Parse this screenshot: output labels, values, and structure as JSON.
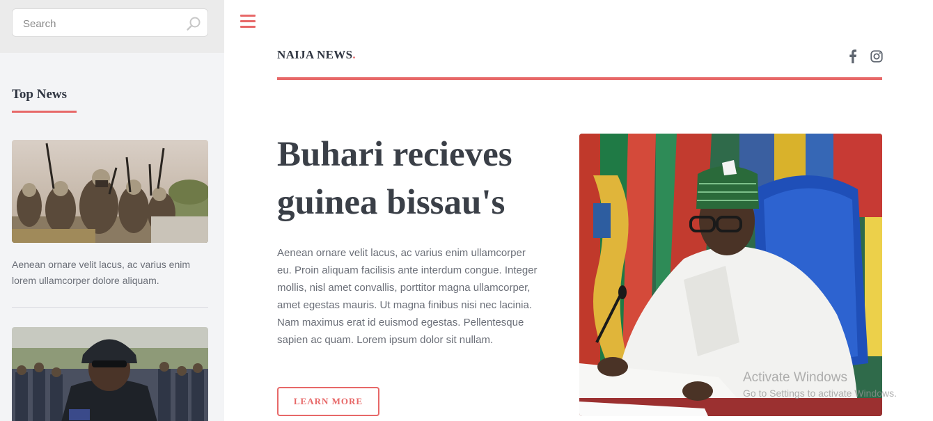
{
  "sidebar": {
    "search": {
      "placeholder": "Search"
    },
    "top_news": {
      "title": "Top News",
      "items": [
        {
          "excerpt": "Aenean ornare velit lacus, ac varius enim lorem ullamcorper dolore aliquam."
        }
      ]
    }
  },
  "header": {
    "brand": "NAIJA NEWS",
    "brand_suffix": ".",
    "social_icons": [
      "facebook-icon",
      "instagram-icon"
    ]
  },
  "article": {
    "headline": "Buhari recieves guinea bissau's",
    "body": "Aenean ornare velit lacus, ac varius enim ullamcorper eu. Proin aliquam facilisis ante interdum congue. Integer mollis, nisl amet convallis, porttitor magna ullamcorper, amet egestas mauris. Ut magna finibus nisi nec lacinia. Nam maximus erat id euismod egestas. Pellentesque sapien ac quam. Lorem ipsum dolor sit nullam.",
    "cta_label": "LEARN MORE"
  },
  "os_watermark": {
    "line1": "Activate Windows",
    "line2": "Go to Settings to activate Windows."
  },
  "colors": {
    "accent": "#e76868",
    "sidebar_bg": "#f3f4f6",
    "heading": "#3a3f47",
    "body_text": "#6b6f78"
  }
}
